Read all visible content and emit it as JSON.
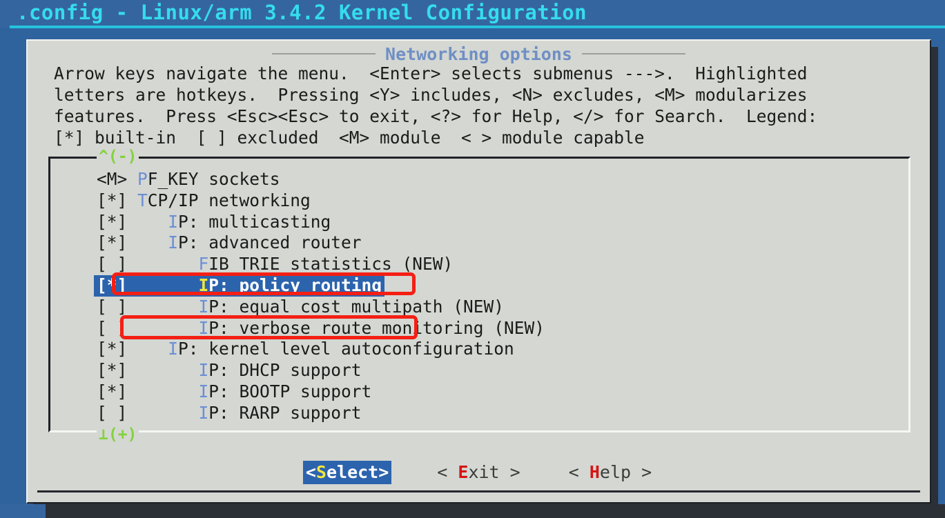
{
  "window": {
    "title": ".config - Linux/arm 3.4.2 Kernel Configuration",
    "title_color": "#35dced",
    "titlebar_color": "#35659f"
  },
  "dialog": {
    "caption": "Networking options",
    "caption_color": "#6f8fc4",
    "background": "#d4d7d2",
    "help_lines": [
      "Arrow keys navigate the menu.  <Enter> selects submenus --->.  Highlighted",
      "letters are hotkeys.  Pressing <Y> includes, <N> excludes, <M> modularizes",
      "features.  Press <Esc><Esc> to exit, <?> for Help, </> for Search.  Legend:",
      "[*] built-in  [ ] excluded  <M> module  < > module capable"
    ]
  },
  "menu": {
    "scroll_up_marker": "^(-)",
    "scroll_down_marker": "⊥(+)",
    "scroll_marker_color": "#83d23c",
    "selection_bg": "#2c63ad",
    "selection_fg": "#ffffff",
    "hotkey_color": "#6b8fd4",
    "selected_hotkey_color": "#f2e63c",
    "items": [
      {
        "state": "<M>",
        "indent": "",
        "hot": "P",
        "rest": "F_KEY sockets",
        "selected": false
      },
      {
        "state": "[*]",
        "indent": "",
        "hot": "T",
        "rest": "CP/IP networking",
        "selected": false
      },
      {
        "state": "[*]",
        "indent": "   ",
        "hot": "I",
        "rest": "P: multicasting",
        "selected": false
      },
      {
        "state": "[*]",
        "indent": "   ",
        "hot": "I",
        "rest": "P: advanced router",
        "selected": false
      },
      {
        "state": "[ ]",
        "indent": "      ",
        "hot": "F",
        "rest": "IB TRIE statistics (NEW)",
        "selected": false
      },
      {
        "state": "[*]",
        "indent": "      ",
        "hot": "I",
        "rest": "P: policy routing",
        "selected": true
      },
      {
        "state": "[ ]",
        "indent": "      ",
        "hot": "I",
        "rest": "P: equal cost multipath (NEW)",
        "selected": false
      },
      {
        "state": "[ ]",
        "indent": "      ",
        "hot": "I",
        "rest": "P: verbose route monitoring (NEW)",
        "selected": false
      },
      {
        "state": "[*]",
        "indent": "   ",
        "hot": "I",
        "rest": "P: kernel level autoconfiguration",
        "selected": false
      },
      {
        "state": "[*]",
        "indent": "      ",
        "hot": "I",
        "rest": "P: DHCP support",
        "selected": false
      },
      {
        "state": "[*]",
        "indent": "      ",
        "hot": "I",
        "rest": "P: BOOTP support",
        "selected": false
      },
      {
        "state": "[ ]",
        "indent": "      ",
        "hot": "I",
        "rest": "P: RARP support",
        "selected": false
      }
    ]
  },
  "annotations": [
    {
      "name": "highlight-ip-advanced-router",
      "color": "#f41f14",
      "target": "IP: advanced router"
    },
    {
      "name": "highlight-ip-policy-routing",
      "color": "#f41f14",
      "target": "IP: policy routing"
    }
  ],
  "buttons": [
    {
      "pre": "<",
      "hot": "S",
      "post": "elect>",
      "active": true
    },
    {
      "pre": "< ",
      "hot": "E",
      "post": "xit >",
      "active": false
    },
    {
      "pre": "< ",
      "hot": "H",
      "post": "elp >",
      "active": false
    }
  ]
}
